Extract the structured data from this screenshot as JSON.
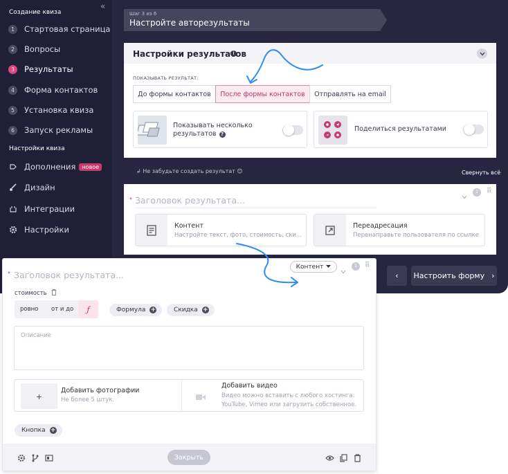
{
  "sidebar": {
    "collapse_icon": "«",
    "section_create": "Создание квиза",
    "steps": [
      {
        "num": "1",
        "label": "Стартовая страница"
      },
      {
        "num": "2",
        "label": "Вопросы"
      },
      {
        "num": "3",
        "label": "Результаты"
      },
      {
        "num": "4",
        "label": "Форма контактов"
      },
      {
        "num": "5",
        "label": "Установка квиза"
      },
      {
        "num": "6",
        "label": "Запуск рекламы"
      }
    ],
    "section_settings": "Настройки квиза",
    "settings": [
      {
        "label": "Дополнения",
        "badge": "новое",
        "icon": "plugin-icon"
      },
      {
        "label": "Дизайн",
        "icon": "brush-icon"
      },
      {
        "label": "Интеграции",
        "icon": "integration-icon"
      },
      {
        "label": "Настройки",
        "icon": "gear-icon"
      }
    ]
  },
  "step_banner": {
    "small": "Шаг 3 из 6",
    "title": "Настройте авторезультаты"
  },
  "settings_card": {
    "title": "Настройки результатов",
    "info": "i",
    "show_label": "ПОКАЗЫВАТЬ РЕЗУЛЬТАТ:",
    "segments": [
      "До формы контактов",
      "После формы контактов",
      "Отправлять на email"
    ],
    "option_multi": "Показывать несколько результатов",
    "question_mark": "?",
    "option_share": "Поделиться результатами"
  },
  "reminder": "Не забудьте создать результат 😊",
  "collapse_all": "Свернуть всё",
  "result_card": {
    "star": "*",
    "placeholder": "Заголовок результата...",
    "badge": "1",
    "types": [
      {
        "title": "Контент",
        "desc": "Настройте текст, фото, стоимость, ски..."
      },
      {
        "title": "Переадресация",
        "desc": "Перенаправьте пользователя по ссылке"
      }
    ]
  },
  "nav": {
    "back_glyph": "‹",
    "next_label": "Настроить форму",
    "next_glyph": "›"
  },
  "editor": {
    "star": "*",
    "placeholder": "Заголовок результата...",
    "dropdown": "Контент",
    "badge": "1",
    "cost_label": "стоимость",
    "price_options": [
      "ровно",
      "от и до",
      "ƒ"
    ],
    "chips": [
      "Формула",
      "Скидка"
    ],
    "plus": "+",
    "desc_placeholder": "Описание",
    "photo_plus": "+",
    "photo_title": "Добавить фотографии",
    "photo_sub": "Не более 5 штук.",
    "video_title": "Добавить видео",
    "video_sub_1": "Видео можно вставить с любого хостинга:",
    "video_sub_2": "YouTube, Vimeo или загрузить собственное.",
    "button_chip": "Кнопка",
    "close": "Закрыть"
  },
  "colors": {
    "sidebar_bg": "#1f1f37",
    "accent": "#e0457b",
    "arrow": "#2f8cf0"
  }
}
